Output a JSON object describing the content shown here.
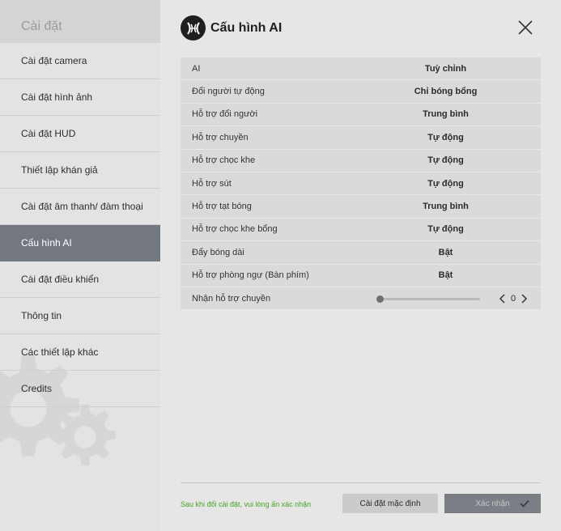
{
  "sidebar": {
    "header": "Cài đặt",
    "items": [
      {
        "label": "Cài đặt camera"
      },
      {
        "label": "Cài đặt hình ảnh"
      },
      {
        "label": "Cài đặt HUD"
      },
      {
        "label": "Thiết lập khán giả"
      },
      {
        "label": "Cài đặt âm thanh/ đàm thoại"
      },
      {
        "label": "Cấu hình AI"
      },
      {
        "label": "Cài đặt điều khiển"
      },
      {
        "label": "Thông tin"
      },
      {
        "label": "Các thiết lập khác"
      },
      {
        "label": "Credits"
      }
    ],
    "active_index": 5
  },
  "main": {
    "title": "Cấu hình AI",
    "settings": [
      {
        "label": "AI",
        "value": "Tuỳ chỉnh"
      },
      {
        "label": "Đổi người tự động",
        "value": "Chỉ bóng bổng"
      },
      {
        "label": "Hỗ trợ đổi người",
        "value": "Trung bình"
      },
      {
        "label": "Hỗ trợ chuyền",
        "value": "Tự động"
      },
      {
        "label": "Hỗ trợ chọc khe",
        "value": "Tự động"
      },
      {
        "label": "Hỗ trợ sút",
        "value": "Tự động"
      },
      {
        "label": "Hỗ trợ tạt bóng",
        "value": "Trung bình"
      },
      {
        "label": "Hỗ trợ chọc khe bổng",
        "value": "Tự động"
      },
      {
        "label": "Đẩy bóng dài",
        "value": "Bật"
      },
      {
        "label": "Hỗ trợ phòng ngự (Bàn phím)",
        "value": "Bật"
      }
    ],
    "slider": {
      "label": "Nhận hỗ trợ chuyền",
      "value": "0",
      "fraction": 0
    }
  },
  "footer": {
    "note": "Sau khi đổi cài đặt, vui lòng ấn xác nhận",
    "default_button": "Cài đặt mặc định",
    "confirm_button": "Xác nhận"
  },
  "colors": {
    "active_sidebar": "#737880",
    "note": "#43a425",
    "confirm_button": "#7b7e84"
  }
}
